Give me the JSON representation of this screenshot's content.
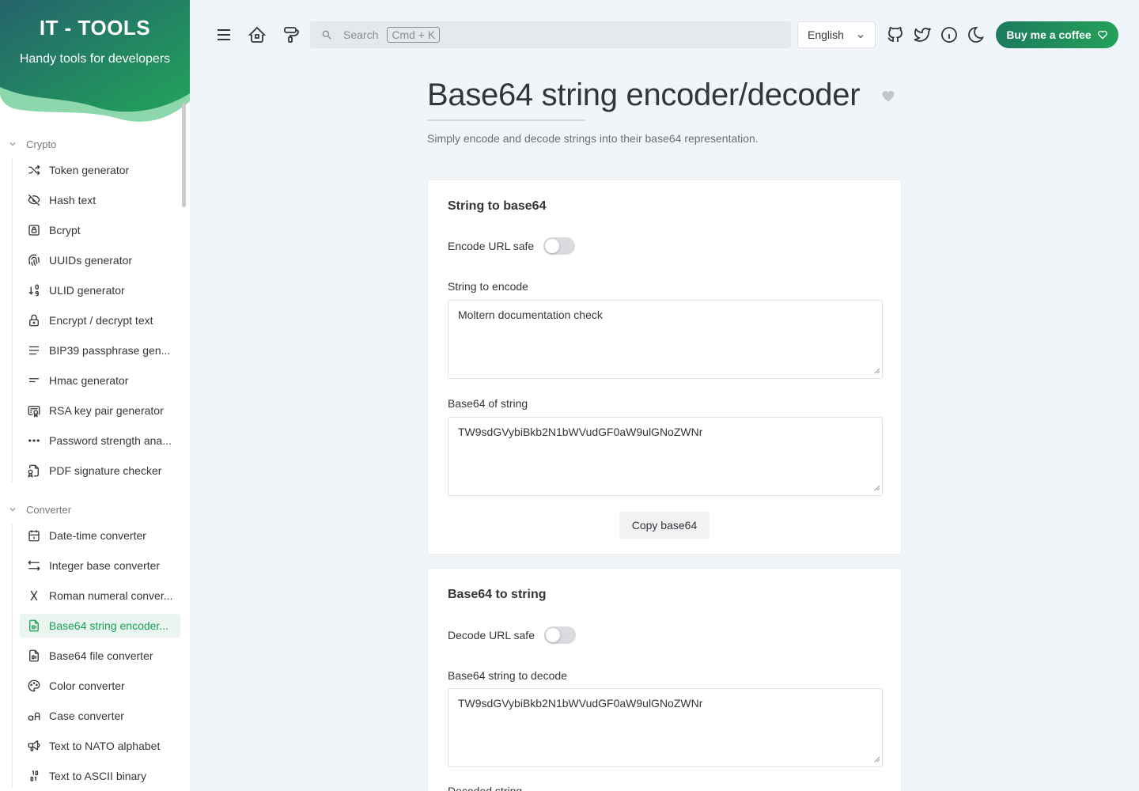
{
  "brand": {
    "title": "IT - TOOLS",
    "subtitle": "Handy tools for developers"
  },
  "sidebar": {
    "groups": [
      {
        "label": "Crypto",
        "items": [
          {
            "label": "Token generator",
            "icon": "shuffle-icon"
          },
          {
            "label": "Hash text",
            "icon": "eye-off-icon"
          },
          {
            "label": "Bcrypt",
            "icon": "lock-square-icon"
          },
          {
            "label": "UUIDs generator",
            "icon": "fingerprint-icon"
          },
          {
            "label": "ULID generator",
            "icon": "sort-numeric-icon"
          },
          {
            "label": "Encrypt / decrypt text",
            "icon": "lock-icon"
          },
          {
            "label": "BIP39 passphrase gen...",
            "icon": "align-justified-icon"
          },
          {
            "label": "Hmac generator",
            "icon": "short-text-icon"
          },
          {
            "label": "RSA key pair generator",
            "icon": "certificate-icon"
          },
          {
            "label": "Password strength ana...",
            "icon": "password-icon"
          },
          {
            "label": "PDF signature checker",
            "icon": "file-certificate-icon"
          }
        ]
      },
      {
        "label": "Converter",
        "items": [
          {
            "label": "Date-time converter",
            "icon": "calendar-icon"
          },
          {
            "label": "Integer base converter",
            "icon": "arrows-left-right-icon"
          },
          {
            "label": "Roman numeral conver...",
            "icon": "letter-x-icon"
          },
          {
            "label": "Base64 string encoder...",
            "icon": "file-digit-icon"
          },
          {
            "label": "Base64 file converter",
            "icon": "file-digit-icon"
          },
          {
            "label": "Color converter",
            "icon": "palette-icon"
          },
          {
            "label": "Case converter",
            "icon": "letter-case-icon"
          },
          {
            "label": "Text to NATO alphabet",
            "icon": "speakerphone-icon"
          },
          {
            "label": "Text to ASCII binary",
            "icon": "binary-icon"
          }
        ]
      }
    ],
    "active_item": "Base64 string encoder..."
  },
  "topbar": {
    "search_placeholder": "Search",
    "search_shortcut": "Cmd + K",
    "language": "English",
    "coffee_label": "Buy me a coffee"
  },
  "page": {
    "title": "Base64 string encoder/decoder",
    "description": "Simply encode and decode strings into their base64 representation."
  },
  "encode_card": {
    "title": "String to base64",
    "toggle_label": "Encode URL safe",
    "toggle_on": false,
    "input_label": "String to encode",
    "input_value": "Moltern documentation check",
    "output_label": "Base64 of string",
    "output_value": "TW9sdGVybiBkb2N1bWVudGF0aW9ulGNoZWNr",
    "copy_label": "Copy base64"
  },
  "decode_card": {
    "title": "Base64 to string",
    "toggle_label": "Decode URL safe",
    "toggle_on": false,
    "input_label": "Base64 string to decode",
    "input_value": "TW9sdGVybiBkb2N1bWVudGF0aW9ulGNoZWNr",
    "output_label": "Decoded string"
  },
  "colors": {
    "accent": "#18a058",
    "brand_dark": "#1d7a60",
    "background": "#f1f5f9"
  }
}
